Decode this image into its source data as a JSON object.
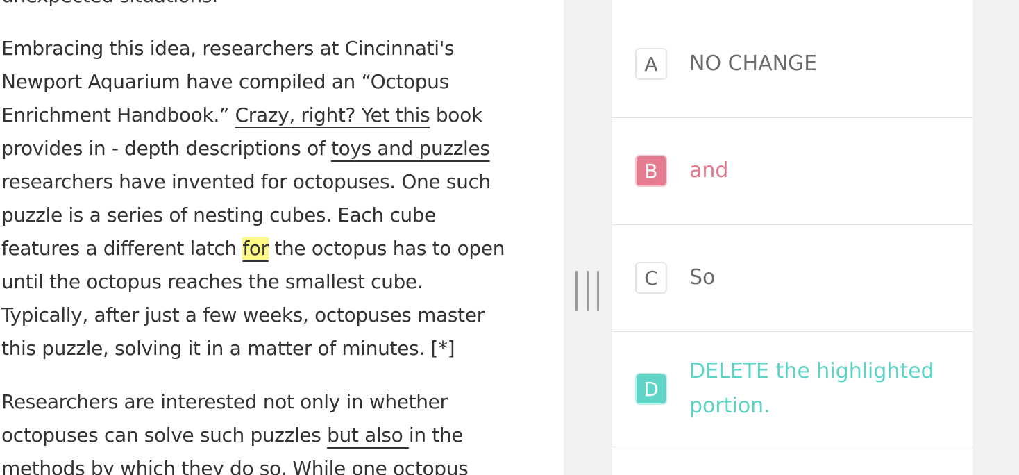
{
  "passage": {
    "top_fragment": "unexpected situations.",
    "para1": {
      "l1": "Embracing this idea, researchers at Cincinnati's",
      "l2": "Newport Aquarium have compiled an “Octopus",
      "l3_pre": "Enrichment Handbook.” ",
      "l3_u": "Crazy, right? Yet this",
      "l3_post": " book",
      "l4_pre": "provides in - depth descriptions of ",
      "l4_u": "toys and puzzles",
      "l5": "researchers have invented for octopuses. One such",
      "l6": "puzzle is a series of nesting cubes. Each cube",
      "l7_pre": "features a different latch ",
      "l7_hl": "for",
      "l7_post": " the octopus has to open",
      "l8": "until the octopus reaches the smallest cube.",
      "l9": "Typically, after just a few weeks, octopuses master",
      "l10": "this puzzle, solving it in a matter of minutes. [*]"
    },
    "para2": {
      "l1": "Researchers are interested not only in whether",
      "l2_pre": "octopuses can solve such puzzles ",
      "l2_u": "but also ",
      "l2_post": "in the",
      "l3": "methods by which they do so. While one octopus"
    }
  },
  "choices": [
    {
      "letter": "A",
      "text": "NO CHANGE"
    },
    {
      "letter": "B",
      "text": "and",
      "color": "#e0788b"
    },
    {
      "letter": "C",
      "text": "So"
    },
    {
      "letter": "D",
      "text": "DELETE the highlighted portion.",
      "color": "#5dd3c6"
    }
  ],
  "colors": {
    "highlight": "#fff986",
    "choice_b": "#e57b8e",
    "choice_d": "#5fd5c8",
    "panel_gray": "#f1f1f1"
  },
  "icons": {
    "splitter": "drag-handle-icon"
  }
}
